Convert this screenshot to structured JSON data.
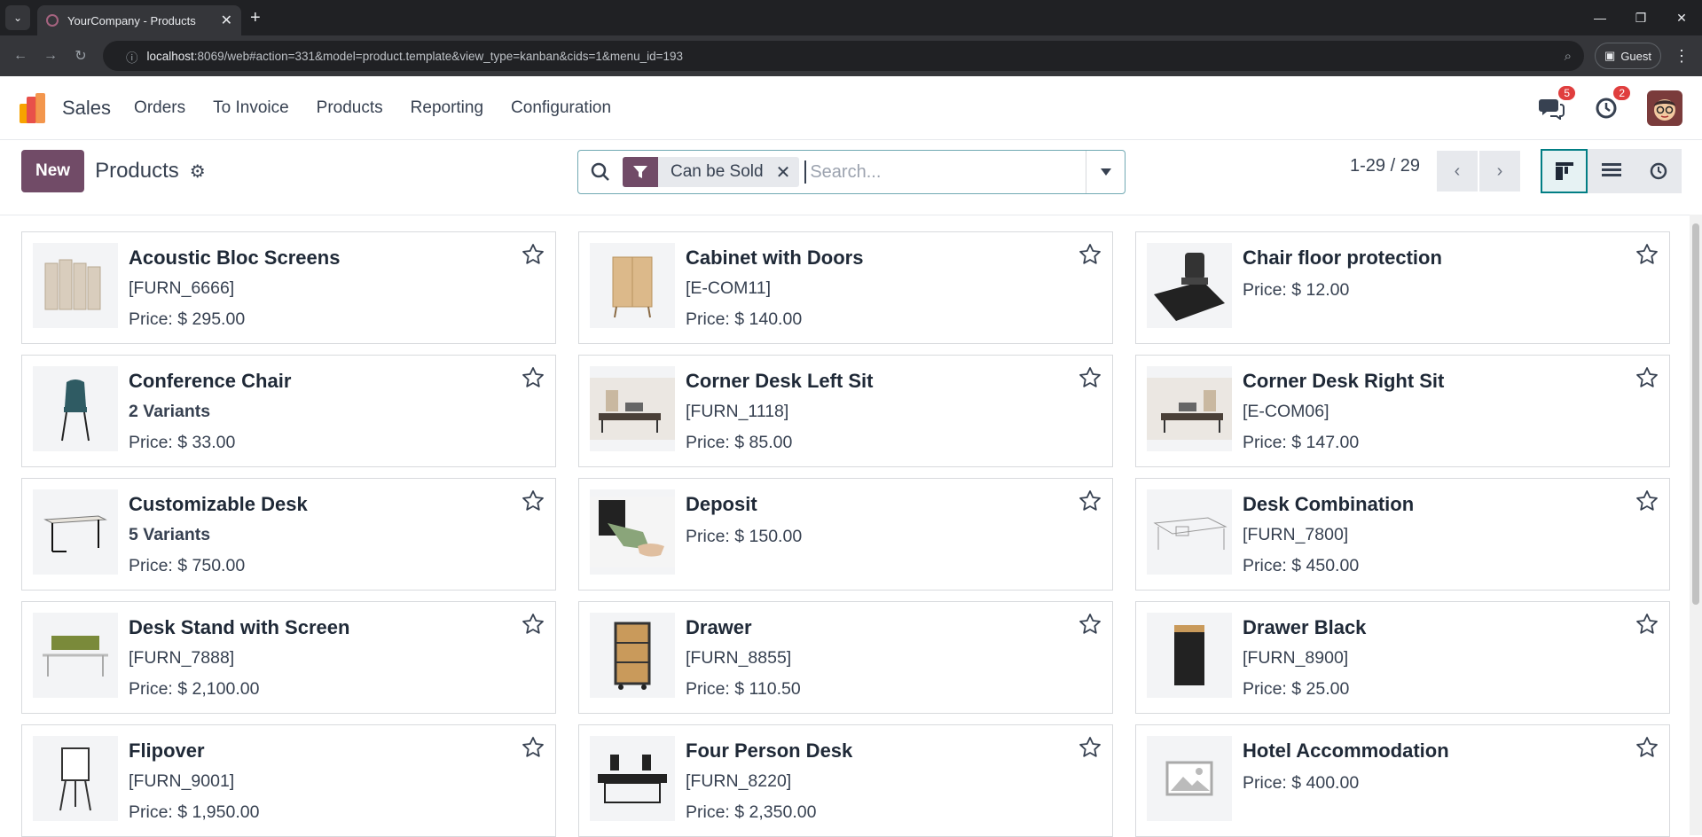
{
  "browser": {
    "tab_title": "YourCompany - Products",
    "url_host": "localhost",
    "url_rest": ":8069/web#action=331&model=product.template&view_type=kanban&cids=1&menu_id=193",
    "guest_label": "Guest"
  },
  "navbar": {
    "app_name": "Sales",
    "menus": [
      "Orders",
      "To Invoice",
      "Products",
      "Reporting",
      "Configuration"
    ],
    "messages_count": "5",
    "activities_count": "2"
  },
  "control": {
    "new_label": "New",
    "title": "Products",
    "facet_label": "Can be Sold",
    "search_placeholder": "Search...",
    "pager": "1-29 / 29"
  },
  "products": [
    {
      "name": "Acoustic Bloc Screens",
      "sub": "[FURN_6666]",
      "sub_bold": false,
      "price": "Price: $ 295.00"
    },
    {
      "name": "Cabinet with Doors",
      "sub": "[E-COM11]",
      "sub_bold": false,
      "price": "Price: $ 140.00"
    },
    {
      "name": "Chair floor protection",
      "sub": "",
      "sub_bold": false,
      "price": "Price: $ 12.00"
    },
    {
      "name": "Conference Chair",
      "sub": "2 Variants",
      "sub_bold": true,
      "price": "Price: $ 33.00"
    },
    {
      "name": "Corner Desk Left Sit",
      "sub": "[FURN_1118]",
      "sub_bold": false,
      "price": "Price: $ 85.00"
    },
    {
      "name": "Corner Desk Right Sit",
      "sub": "[E-COM06]",
      "sub_bold": false,
      "price": "Price: $ 147.00"
    },
    {
      "name": "Customizable Desk",
      "sub": "5 Variants",
      "sub_bold": true,
      "price": "Price: $ 750.00"
    },
    {
      "name": "Deposit",
      "sub": "",
      "sub_bold": false,
      "price": "Price: $ 150.00"
    },
    {
      "name": "Desk Combination",
      "sub": "[FURN_7800]",
      "sub_bold": false,
      "price": "Price: $ 450.00"
    },
    {
      "name": "Desk Stand with Screen",
      "sub": "[FURN_7888]",
      "sub_bold": false,
      "price": "Price: $ 2,100.00"
    },
    {
      "name": "Drawer",
      "sub": "[FURN_8855]",
      "sub_bold": false,
      "price": "Price: $ 110.50"
    },
    {
      "name": "Drawer Black",
      "sub": "[FURN_8900]",
      "sub_bold": false,
      "price": "Price: $ 25.00"
    },
    {
      "name": "Flipover",
      "sub": "[FURN_9001]",
      "sub_bold": false,
      "price": "Price: $ 1,950.00"
    },
    {
      "name": "Four Person Desk",
      "sub": "[FURN_8220]",
      "sub_bold": false,
      "price": "Price: $ 2,350.00"
    },
    {
      "name": "Hotel Accommodation",
      "sub": "",
      "sub_bold": false,
      "price": "Price: $ 400.00"
    }
  ]
}
